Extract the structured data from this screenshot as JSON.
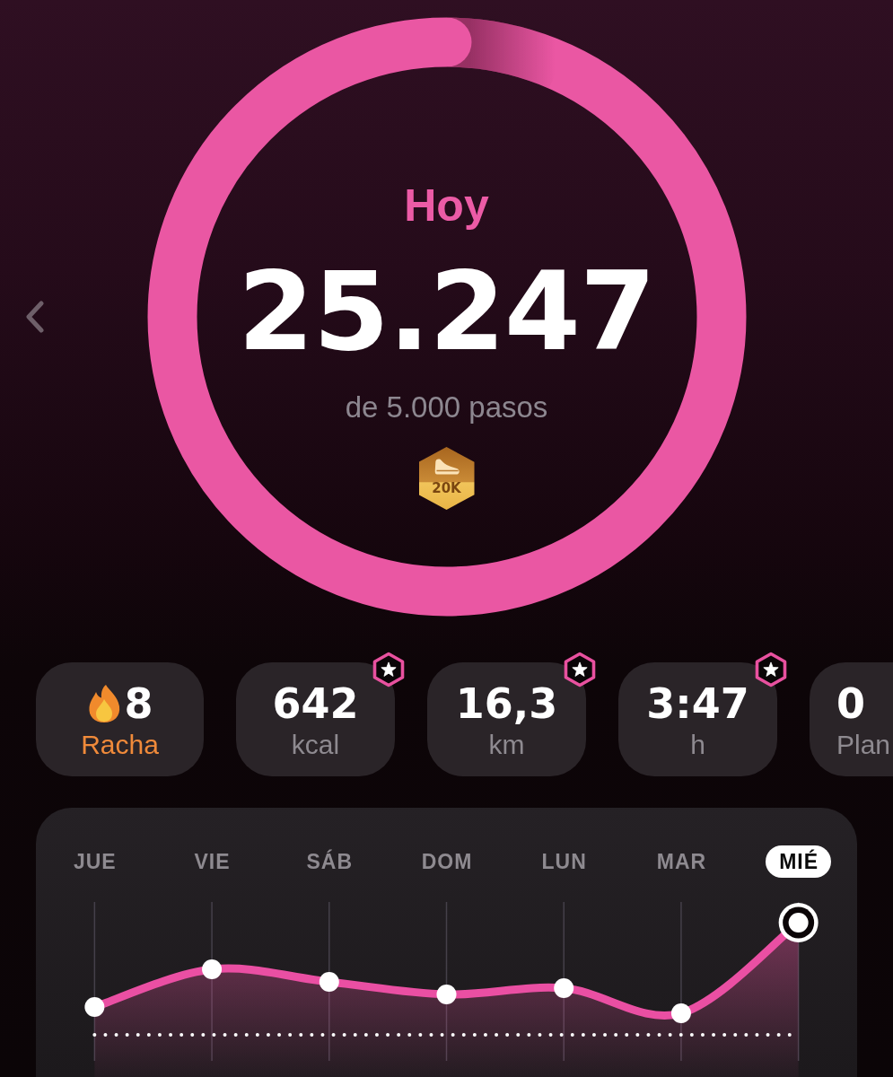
{
  "goal_ring": {
    "title": "Hoy",
    "steps": "25.247",
    "goal": "de 5.000 pasos",
    "level": 1,
    "medal": {
      "label": "20K"
    }
  },
  "stats": [
    {
      "kind": "streak",
      "value": "8",
      "label": "Racha",
      "achievement": false
    },
    {
      "kind": "metric",
      "value": "642",
      "label": "kcal",
      "achievement": true
    },
    {
      "kind": "metric",
      "value": "16,3",
      "label": "km",
      "achievement": true
    },
    {
      "kind": "metric",
      "value": "3:47",
      "label": "h",
      "achievement": true
    },
    {
      "kind": "metric",
      "value": "0",
      "label": "Plan",
      "achievement": false
    }
  ],
  "week_chart": {
    "days": [
      {
        "label": "JUE",
        "selected": false
      },
      {
        "label": "VIE",
        "selected": false
      },
      {
        "label": "SÁB",
        "selected": false
      },
      {
        "label": "DOM",
        "selected": false
      },
      {
        "label": "LUN",
        "selected": false
      },
      {
        "label": "MAR",
        "selected": false
      },
      {
        "label": "MIÉ",
        "selected": true
      }
    ]
  }
}
